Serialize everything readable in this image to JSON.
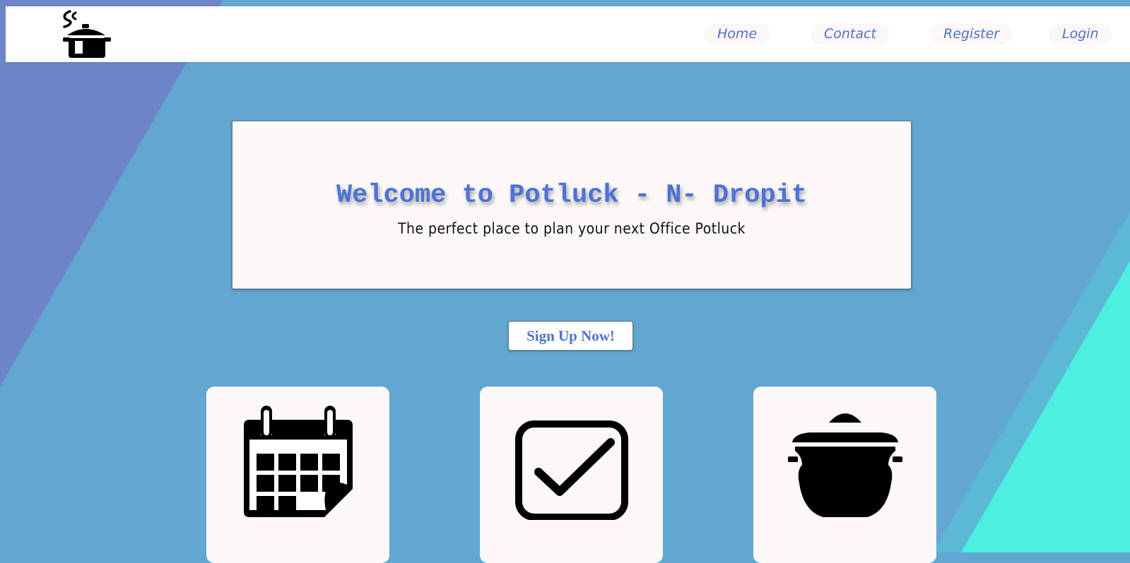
{
  "nav": {
    "logo_icon": "steaming-pot-icon",
    "links": [
      {
        "label": "Home"
      },
      {
        "label": "Contact"
      },
      {
        "label": "Register"
      },
      {
        "label": "Login"
      }
    ],
    "link_color": "#4a72d8"
  },
  "hero": {
    "title": "Welcome to Potluck - N- Dropit",
    "subtitle": "The perfect place to plan your next Office Potluck"
  },
  "cta": {
    "label": "Sign Up Now!"
  },
  "features": [
    {
      "icon": "calendar-icon"
    },
    {
      "icon": "checkbox-icon"
    },
    {
      "icon": "cooking-pot-icon"
    }
  ],
  "colors": {
    "background": "#62a7d1",
    "accent_left": "#6e84c8",
    "accent_right": "#4cefe0",
    "brand_text": "#4a72d8"
  }
}
